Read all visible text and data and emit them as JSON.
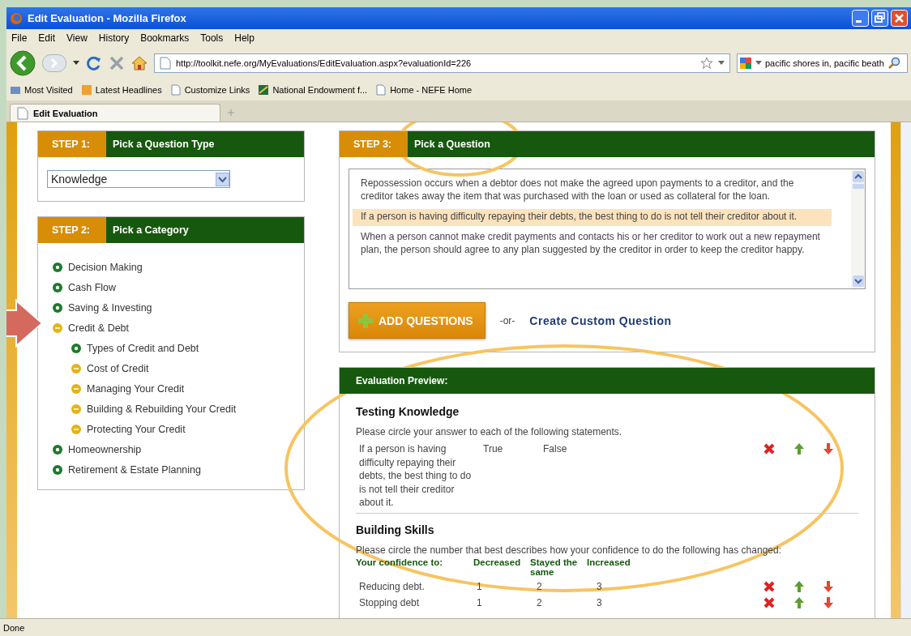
{
  "window": {
    "title": "Edit Evaluation - Mozilla Firefox"
  },
  "menu": [
    "File",
    "Edit",
    "View",
    "History",
    "Bookmarks",
    "Tools",
    "Help"
  ],
  "address": {
    "value": "http://toolkit.nefe.org/MyEvaluations/EditEvaluation.aspx?evaluationId=226"
  },
  "search": {
    "value": "pacific shores in, pacific beath"
  },
  "bookmarks": [
    "Most Visited",
    "Latest Headlines",
    "Customize Links",
    "National Endowment f...",
    "Home - NEFE Home"
  ],
  "tabs": [
    {
      "label": "Edit Evaluation",
      "selected": true
    }
  ],
  "step1": {
    "step": "STEP 1:",
    "title": "Pick a Question Type",
    "select": "Knowledge"
  },
  "step2": {
    "step": "STEP 2:",
    "title": "Pick a Category",
    "categories": [
      {
        "label": "Decision Making",
        "selected": false
      },
      {
        "label": "Cash Flow",
        "selected": false
      },
      {
        "label": "Saving & Investing",
        "selected": false
      },
      {
        "label": "Credit & Debt",
        "selected": true,
        "children": [
          {
            "label": "Types of Credit and Debt",
            "selected": false
          },
          {
            "label": "Cost of Credit",
            "selected": true
          },
          {
            "label": "Managing Your Credit",
            "selected": true
          },
          {
            "label": "Building & Rebuilding Your Credit",
            "selected": true
          },
          {
            "label": "Protecting Your Credit",
            "selected": true
          }
        ]
      },
      {
        "label": "Homeownership",
        "selected": false
      },
      {
        "label": "Retirement & Estate Planning",
        "selected": false
      }
    ]
  },
  "step3": {
    "step": "STEP 3:",
    "title": "Pick a Question",
    "questions": [
      {
        "text": "Repossession occurs when a debtor does not make the agreed upon payments to a creditor, and the creditor takes away the item that was purchased with the loan or used as collateral for the loan.",
        "selected": false
      },
      {
        "text": "If a person is having difficulty repaying their debts, the best thing to do is not tell their creditor about it.",
        "selected": true
      },
      {
        "text": "When a person cannot make credit payments and contacts his or her creditor to work out a new repayment plan, the person should agree to any plan suggested by the creditor in order to keep the creditor happy.",
        "selected": false
      }
    ],
    "add_button": "ADD QUESTIONS",
    "or": "-or-",
    "custom_link": "Create Custom Question"
  },
  "preview": {
    "title": "Evaluation Preview:",
    "sections": [
      {
        "kind": "truefalse",
        "heading": "Testing Knowledge",
        "instructions": "Please circle your answer to each of the following statements.",
        "rows": [
          {
            "statement": "If a person is having difficulty repaying their debts, the best thing to do is not tell their creditor about it.",
            "options": [
              "True",
              "False"
            ]
          }
        ]
      },
      {
        "kind": "scale",
        "heading": "Building Skills",
        "instructions": "Please circle the number that best describes how your confidence to do the following has changed:",
        "columns": [
          "Your confidence to:",
          "Decreased",
          "Stayed the same",
          "Increased"
        ],
        "rows": [
          {
            "statement": "Reducing debt.",
            "options": [
              "1",
              "2",
              "3"
            ]
          },
          {
            "statement": "Stopping debt",
            "options": [
              "1",
              "2",
              "3"
            ]
          }
        ]
      }
    ]
  },
  "status_bar": "Done"
}
